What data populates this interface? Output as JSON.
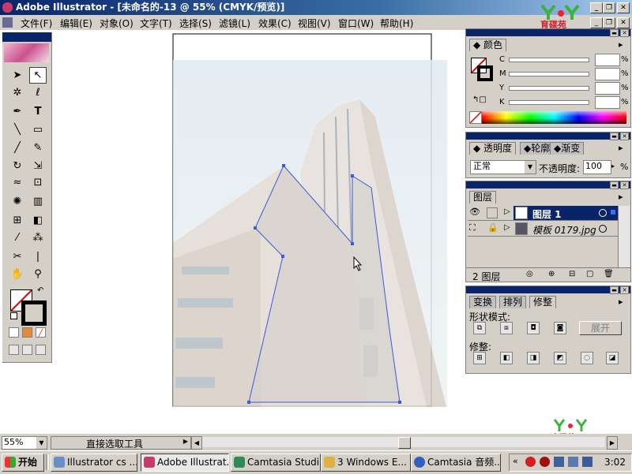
{
  "window": {
    "title": "Adobe Illustrator - [未命名的-13 @ 55% (CMYK/预览)]",
    "controls": [
      "_",
      "❐",
      "✕"
    ]
  },
  "menubar": {
    "items": [
      "文件(F)",
      "编辑(E)",
      "对象(O)",
      "文字(T)",
      "选择(S)",
      "滤镜(L)",
      "效果(C)",
      "视图(V)",
      "窗口(W)",
      "帮助(H)"
    ],
    "doc_controls": [
      "_",
      "❐",
      "✕"
    ]
  },
  "logo_text": "育碟苑",
  "color_panel": {
    "tab": "颜色",
    "channels": [
      "C",
      "M",
      "Y",
      "K"
    ],
    "unit": "%"
  },
  "transparency_panel": {
    "tabs": [
      "透明度",
      "轮廓",
      "渐变"
    ],
    "blend_mode": "正常",
    "opacity_label": "不透明度:",
    "opacity_value": "100",
    "unit": "%"
  },
  "layers_panel": {
    "tab": "图层",
    "layers": [
      {
        "name": "图层 1",
        "selected": true
      },
      {
        "name": "模板 0179.jpg",
        "selected": false
      }
    ],
    "footer_count": "2 图层"
  },
  "pathfinder_panel": {
    "tabs": [
      "变换",
      "排列",
      "修整"
    ],
    "shape_modes_label": "形状模式:",
    "expand_button": "展开",
    "pathfinders_label": "修整:"
  },
  "statusbar": {
    "zoom": "55%",
    "current_tool": "直接选取工具"
  },
  "taskbar": {
    "start_label": "开始",
    "tasks": [
      {
        "label": "Illustrator cs ...",
        "active": false,
        "color": "#6a8cc8"
      },
      {
        "label": "Adobe Illustrat...",
        "active": true,
        "color": "#c83a6a"
      },
      {
        "label": "Camtasia Studi...",
        "active": false,
        "color": "#2e8b57"
      },
      {
        "label": "3 Windows E...",
        "active": false,
        "color": "#e0b040"
      },
      {
        "label": "Camtasia 音频...",
        "active": false,
        "color": "#3060c0"
      }
    ],
    "clock": "3:02"
  },
  "colors": {
    "title_start": "#0a246a",
    "panel_bg": "#d4d0c8",
    "selection": "#0a246a",
    "path_blue": "#3a5ad8"
  }
}
